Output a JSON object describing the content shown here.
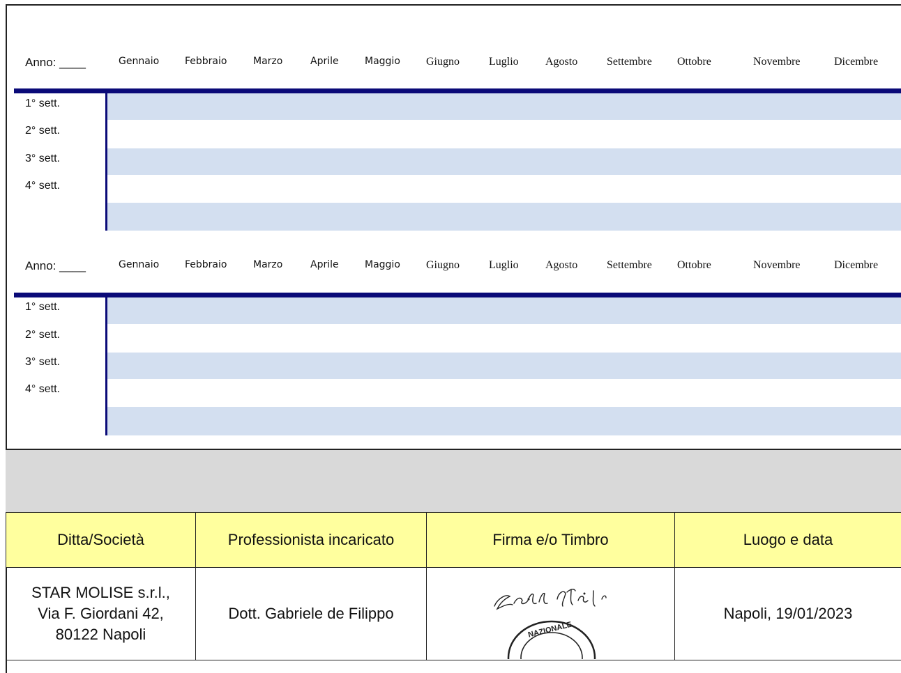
{
  "calendar": {
    "year_label": "Anno: ____",
    "months": [
      "Gennaio",
      "Febbraio",
      "Marzo",
      "Aprile",
      "Maggio",
      "Giugno",
      "Luglio",
      "Agosto",
      "Settembre",
      "Ottobre",
      "Novembre",
      "Dicembre"
    ],
    "weeks": [
      "1° sett.",
      "2° sett.",
      "3° sett.",
      "4° sett."
    ]
  },
  "signature_table": {
    "headers": [
      "Ditta/Società",
      "Professionista incaricato",
      "Firma e/o Timbro",
      "Luogo e data"
    ],
    "company": [
      "STAR MOLISE s.r.l.,",
      "Via F. Giordani 42,",
      "80122 Napoli"
    ],
    "professional": "Dott. Gabriele de Filippo",
    "place_date": "Napoli, 19/01/2023",
    "stamp_text": "NAZIONALE"
  },
  "colors": {
    "bar": "#0a0a78",
    "stripe": "#d3dff0",
    "header_bg": "#ffff9e",
    "band": "#d9d9d9"
  }
}
